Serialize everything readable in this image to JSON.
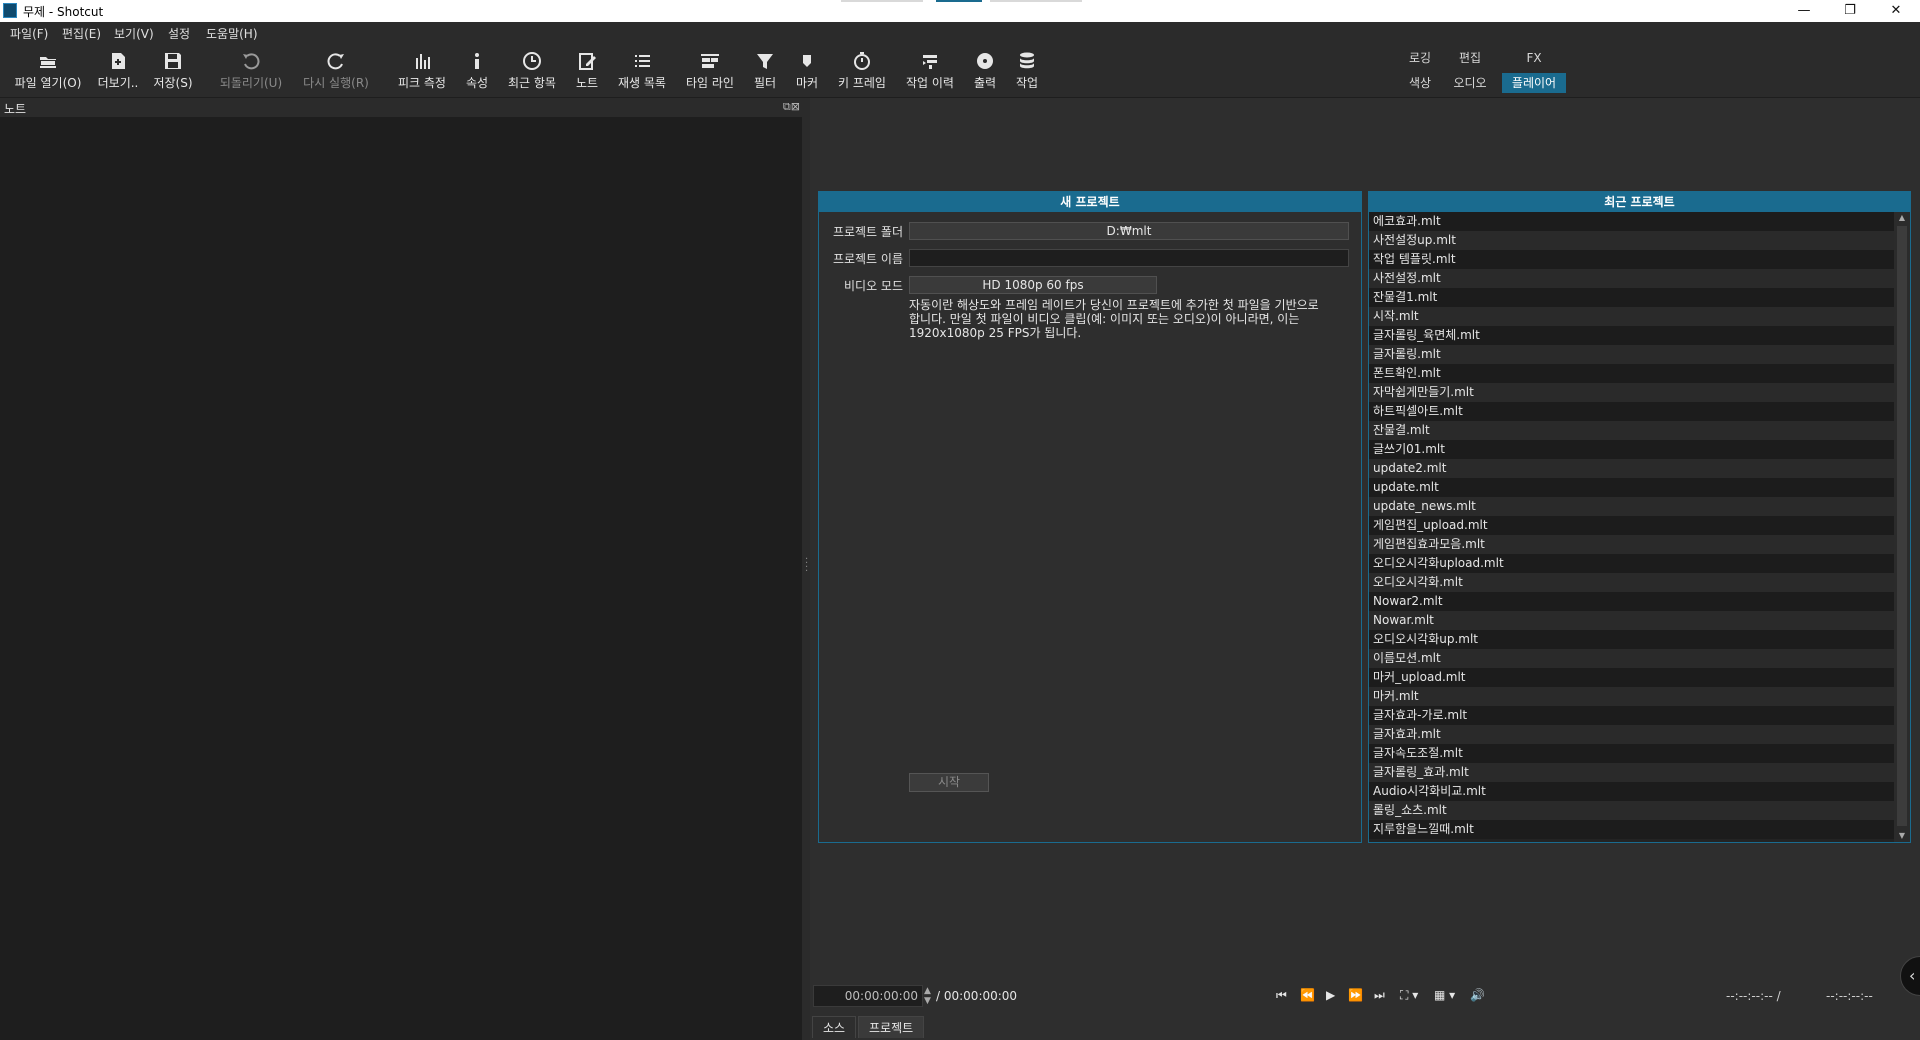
{
  "window": {
    "title": "무제 - Shotcut",
    "minimize": "—",
    "restore": "❐",
    "close": "✕"
  },
  "menu": [
    "파일(F)",
    "편집(E)",
    "보기(V)",
    "설정",
    "도움말(H)"
  ],
  "toolbar": {
    "open_file": "파일 열기(O)",
    "open_other": "더보기..",
    "save": "저장(S)",
    "undo": "되돌리기(U)",
    "redo": "다시 실행(R)",
    "peak_meter": "피크 측정",
    "properties": "속성",
    "recent": "최근 항목",
    "notes": "노트",
    "playlist": "재생 목록",
    "timeline": "타임 라인",
    "filters": "필터",
    "markers": "마커",
    "keyframes": "키 프레임",
    "history": "작업 이력",
    "export": "출력",
    "jobs": "작업"
  },
  "layouts": {
    "logging": "로깅",
    "editing": "편집",
    "fx": "FX",
    "color": "색상",
    "audio": "오디오",
    "player": "플레이어"
  },
  "notes_panel": {
    "title": "노트"
  },
  "new_project": {
    "title": "새 프로젝트",
    "folder_label": "프로젝트 폴더",
    "folder_value": "D:₩mlt",
    "name_label": "프로젝트 이름",
    "name_value": "",
    "video_mode_label": "비디오 모드",
    "video_mode_value": "HD 1080p 60 fps",
    "description": "자동이란 해상도와 프레임 레이트가 당신이 프로젝트에 추가한 첫 파일을 기반으로 합니다. 만일 첫 파일이 비디오 클립(예: 이미지 또는 오디오)이 아니라면, 이는 1920x1080p 25 FPS가 됩니다.",
    "start_button": "시작"
  },
  "recent_projects": {
    "title": "최근 프로젝트",
    "items": [
      "에코효과.mlt",
      "사전설정up.mlt",
      "작업 템플릿.mlt",
      "사전설정.mlt",
      "잔물결1.mlt",
      "시작.mlt",
      "글자롤링_육면체.mlt",
      "글자롤링.mlt",
      "폰트확인.mlt",
      "자막쉽게만들기.mlt",
      "하트픽셀아트.mlt",
      "잔물결.mlt",
      "글쓰기01.mlt",
      "update2.mlt",
      "update.mlt",
      "update_news.mlt",
      "게임편집_upload.mlt",
      "게임편집효과모음.mlt",
      "오디오시각화upload.mlt",
      "오디오시각화.mlt",
      "Nowar2.mlt",
      "Nowar.mlt",
      "오디오시각화up.mlt",
      "이름모션.mlt",
      "마커_upload.mlt",
      "마커.mlt",
      "글자효과-가로.mlt",
      "글자효과.mlt",
      "글자속도조절.mlt",
      "글자롤링_효과.mlt",
      "Audio시각화비교.mlt",
      "롤링_쇼츠.mlt",
      "지루함을느낄때.mlt"
    ]
  },
  "transport": {
    "current_time": "00:00:00:00",
    "total_time": "/ 00:00:00:00",
    "in_point": "--:--:--:-- /",
    "out_point": "--:--:--:--"
  },
  "bottom_tabs": {
    "source": "소스",
    "project": "프로젝트"
  },
  "colors": {
    "accent": "#1a6b8f",
    "background": "#2b2b2b",
    "panel_dark": "#1e1e1e"
  }
}
